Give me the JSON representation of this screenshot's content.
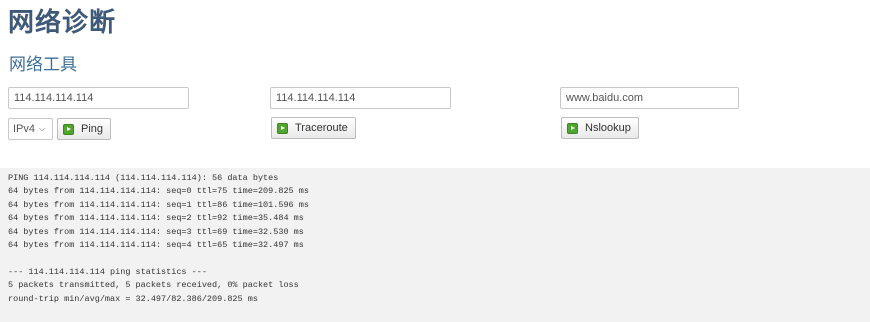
{
  "page_title": "网络诊断",
  "section_title": "网络工具",
  "ping": {
    "input_value": "114.114.114.114",
    "ip_version": "IPv4",
    "button_label": "Ping"
  },
  "traceroute": {
    "input_value": "114.114.114.114",
    "button_label": "Traceroute"
  },
  "nslookup": {
    "input_value": "www.baidu.com",
    "button_label": "Nslookup"
  },
  "icons": {
    "button_icon": "play-icon",
    "select_icon": "chevron-down-icon"
  },
  "output": {
    "lines": [
      "PING 114.114.114.114 (114.114.114.114): 56 data bytes",
      "64 bytes from 114.114.114.114: seq=0 ttl=75 time=209.825 ms",
      "64 bytes from 114.114.114.114: seq=1 ttl=86 time=101.596 ms",
      "64 bytes from 114.114.114.114: seq=2 ttl=92 time=35.484 ms",
      "64 bytes from 114.114.114.114: seq=3 ttl=69 time=32.530 ms",
      "64 bytes from 114.114.114.114: seq=4 ttl=65 time=32.497 ms",
      "",
      "--- 114.114.114.114 ping statistics ---",
      "5 packets transmitted, 5 packets received, 0% packet loss",
      "round-trip min/avg/max = 32.497/82.386/209.825 ms"
    ]
  }
}
